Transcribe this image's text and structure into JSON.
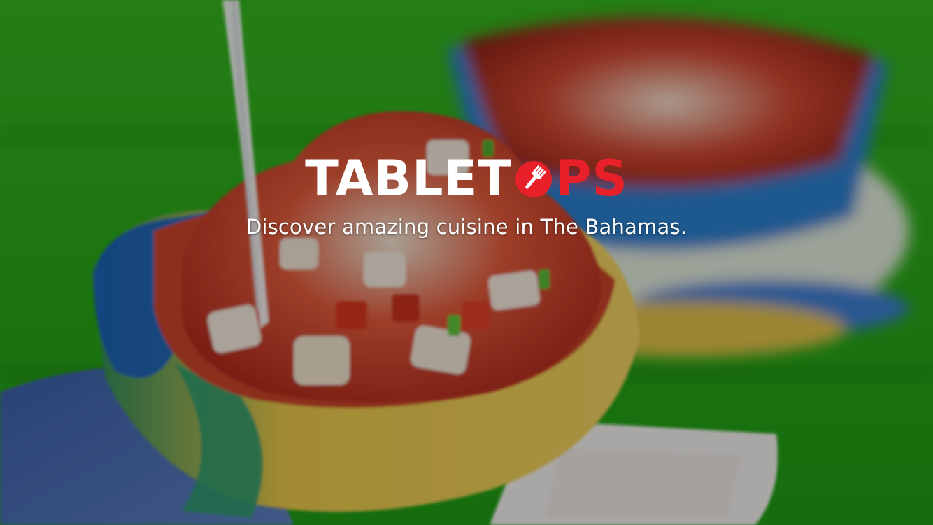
{
  "splash": {
    "logo_part1": "TABLET",
    "logo_part2_o_icon": "fork-in-circle-icon",
    "logo_part3": "PS",
    "tagline": "Discover amazing cuisine in The Bahamas."
  },
  "background": {
    "image": "conch-salad-in-bowls-photo"
  },
  "colors": {
    "brand_white": "#ffffff",
    "brand_red": "#e8202a",
    "table_green": "#2fae1e"
  }
}
